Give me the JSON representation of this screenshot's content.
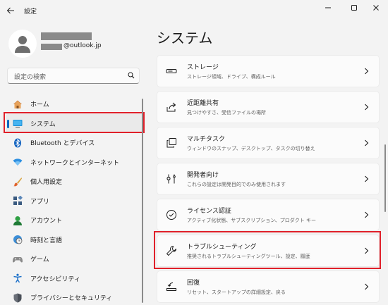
{
  "app": {
    "title": "設定"
  },
  "profile": {
    "email_suffix": "@outlook.jp"
  },
  "search": {
    "placeholder": "設定の検索"
  },
  "page": {
    "title": "システム"
  },
  "nav": {
    "items": [
      {
        "label": "ホーム",
        "icon": "home-icon"
      },
      {
        "label": "システム",
        "icon": "monitor-icon",
        "selected": true
      },
      {
        "label": "Bluetooth とデバイス",
        "icon": "bluetooth-icon"
      },
      {
        "label": "ネットワークとインターネット",
        "icon": "network-icon"
      },
      {
        "label": "個人用設定",
        "icon": "brush-icon"
      },
      {
        "label": "アプリ",
        "icon": "apps-icon"
      },
      {
        "label": "アカウント",
        "icon": "account-icon"
      },
      {
        "label": "時刻と言語",
        "icon": "clock-globe-icon"
      },
      {
        "label": "ゲーム",
        "icon": "gamepad-icon"
      },
      {
        "label": "アクセシビリティ",
        "icon": "accessibility-icon"
      },
      {
        "label": "プライバシーとセキュリティ",
        "icon": "shield-icon"
      }
    ]
  },
  "cards": [
    {
      "title": "ストレージ",
      "desc": "ストレージ領域、ドライブ、構成ルール",
      "icon": "storage-icon"
    },
    {
      "title": "近距離共有",
      "desc": "見つけやすさ、受信ファイルの場所",
      "icon": "share-icon"
    },
    {
      "title": "マルチタスク",
      "desc": "ウィンドウのスナップ、デスクトップ、タスクの切り替え",
      "icon": "multitask-icon"
    },
    {
      "title": "開発者向け",
      "desc": "これらの設定は開発目的でのみ使用されます",
      "icon": "developer-icon"
    },
    {
      "title": "ライセンス認証",
      "desc": "アクティブ化状態、サブスクリプション、プロダクト キー",
      "icon": "activation-icon"
    },
    {
      "title": "トラブルシューティング",
      "desc": "推奨されるトラブルシューティングツール、設定、履歴",
      "icon": "wrench-icon"
    },
    {
      "title": "回復",
      "desc": "リセット、スタートアップの詳細設定、戻る",
      "icon": "recovery-icon"
    }
  ],
  "colors": {
    "accent": "#0067c0",
    "highlight": "#e0202a",
    "background": "#f3f3f3",
    "card": "#fbfbfb"
  }
}
